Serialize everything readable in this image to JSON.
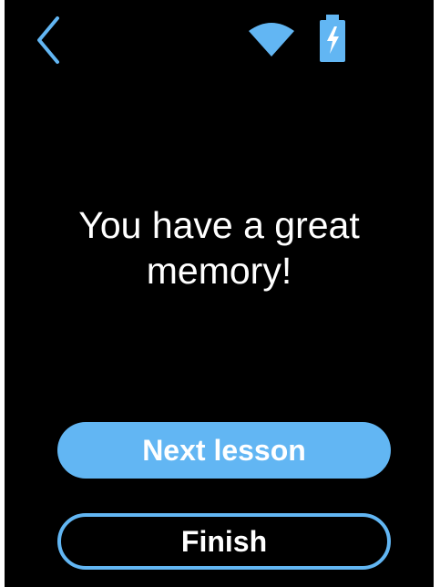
{
  "colors": {
    "accent": "#62b6f3",
    "background": "#000000",
    "text": "#ffffff"
  },
  "status_bar": {
    "back_icon": "chevron-left-icon",
    "wifi_icon": "wifi-icon",
    "battery_icon": "battery-charging-icon"
  },
  "message": {
    "text": "You have a great\nmemory!"
  },
  "buttons": {
    "next_label": "Next lesson",
    "finish_label": "Finish"
  }
}
